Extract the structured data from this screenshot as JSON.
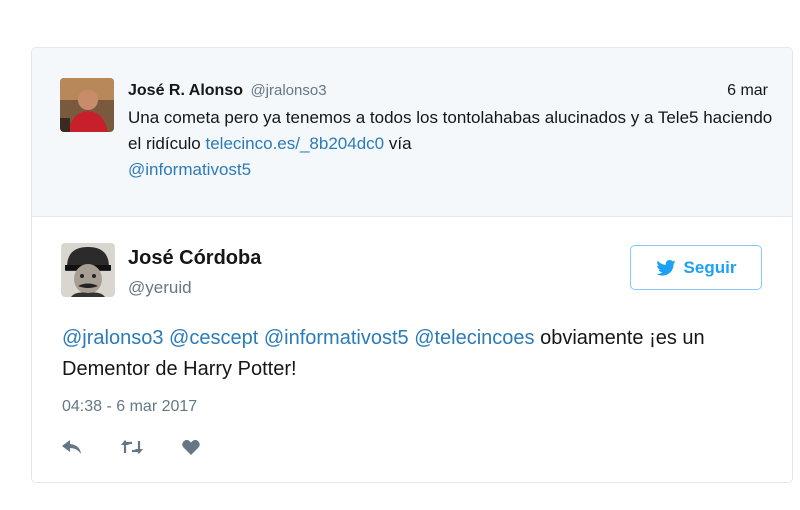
{
  "quoted_tweet": {
    "name": "José R. Alonso",
    "handle": "@jralonso3",
    "date": "6 mar",
    "text_before": "Una cometa pero ya tenemos a todos los tontolahabas alucinados y a Tele5 haciendo el ridículo ",
    "link": "telecinco.es/_8b204dc0",
    "text_via": " vía ",
    "mention": "@informativost5"
  },
  "main_tweet": {
    "name": "José Córdoba",
    "handle": "@yeruid",
    "follow_label": "Seguir",
    "mentions": [
      "@jralonso3",
      "@cescept",
      "@informativost5",
      "@telecincoes"
    ],
    "text": " obviamente ¡es un Dementor de Harry Potter!",
    "timestamp": "04:38 - 6 mar 2017"
  },
  "actions": [
    "reply-icon",
    "retweet-icon",
    "like-icon"
  ],
  "colors": {
    "link": "#2b7bb9",
    "twitter_blue": "#1da1f2",
    "muted": "#657786",
    "quoted_bg": "#f5f8fa"
  }
}
